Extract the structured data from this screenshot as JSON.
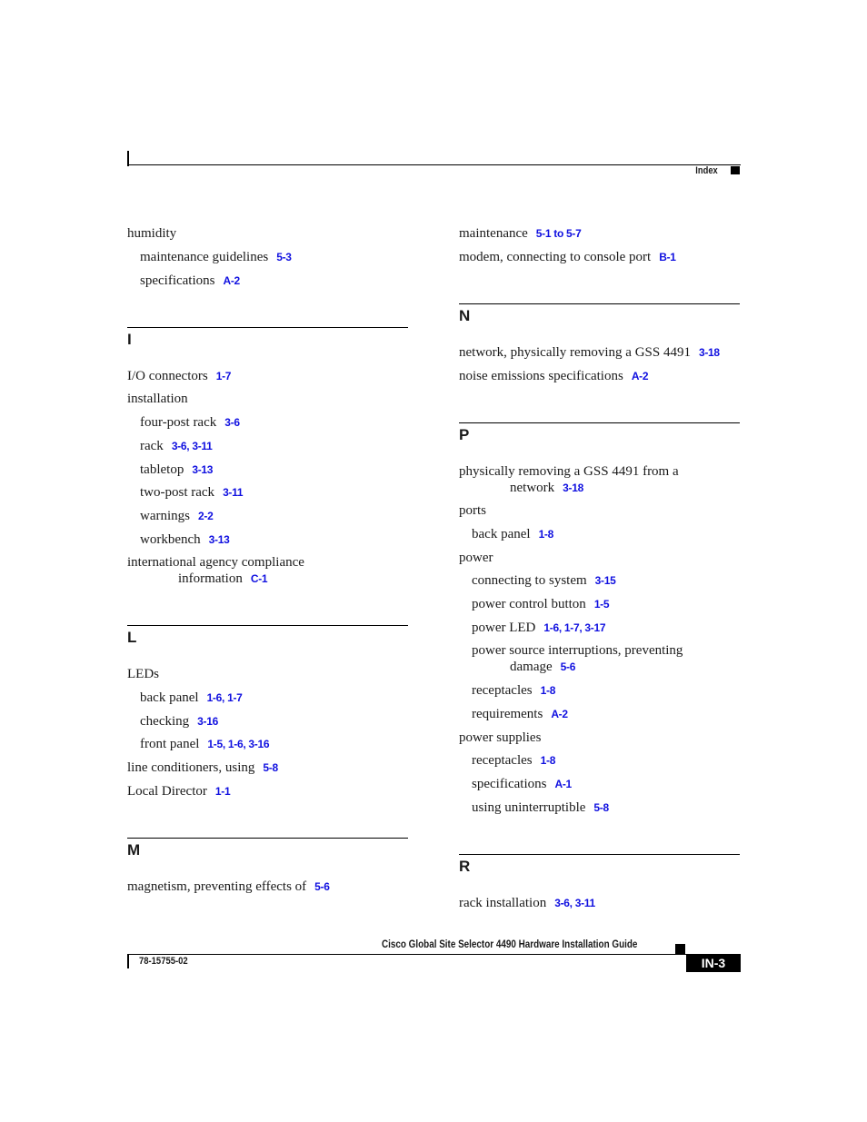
{
  "header": {
    "section_label": "Index"
  },
  "left_column": {
    "pre_entries": [
      {
        "term": "humidity",
        "refs": ""
      },
      {
        "term": "maintenance guidelines",
        "refs": "5-3"
      },
      {
        "term": "specifications",
        "refs": "A-2"
      }
    ],
    "sections": [
      {
        "letter": "I",
        "entries": [
          {
            "term": "I/O connectors",
            "refs": "1-7"
          },
          {
            "term": "installation",
            "refs": ""
          },
          {
            "term": "four-post rack",
            "refs": "3-6"
          },
          {
            "term": "rack",
            "refs": "3-6, 3-11"
          },
          {
            "term": "tabletop",
            "refs": "3-13"
          },
          {
            "term": "two-post rack",
            "refs": "3-11"
          },
          {
            "term": "warnings",
            "refs": "2-2"
          },
          {
            "term": "workbench",
            "refs": "3-13"
          },
          {
            "term": "international agency compliance",
            "cont": "information",
            "refs": "C-1"
          }
        ]
      },
      {
        "letter": "L",
        "entries": [
          {
            "term": "LEDs",
            "refs": ""
          },
          {
            "term": "back panel",
            "refs": "1-6, 1-7"
          },
          {
            "term": "checking",
            "refs": "3-16"
          },
          {
            "term": "front panel",
            "refs": "1-5, 1-6, 3-16"
          },
          {
            "term": "line conditioners, using",
            "refs": "5-8"
          },
          {
            "term": "Local Director",
            "refs": "1-1"
          }
        ]
      },
      {
        "letter": "M",
        "entries": [
          {
            "term": "magnetism, preventing effects of",
            "refs": "5-6"
          }
        ]
      }
    ]
  },
  "right_column": {
    "pre_entries": [
      {
        "term": "maintenance",
        "refs": "5-1 to 5-7"
      },
      {
        "term": "modem, connecting to console port",
        "refs": "B-1"
      }
    ],
    "sections": [
      {
        "letter": "N",
        "entries": [
          {
            "term": "network, physically removing a GSS 4491",
            "refs": "3-18"
          },
          {
            "term": "noise emissions specifications",
            "refs": "A-2"
          }
        ]
      },
      {
        "letter": "P",
        "entries": [
          {
            "term": "physically removing a GSS 4491 from a",
            "cont": "network",
            "refs": "3-18"
          },
          {
            "term": "ports",
            "refs": ""
          },
          {
            "term": "back panel",
            "refs": "1-8"
          },
          {
            "term": "power",
            "refs": ""
          },
          {
            "term": "connecting to system",
            "refs": "3-15"
          },
          {
            "term": "power control button",
            "refs": "1-5"
          },
          {
            "term": "power LED",
            "refs": "1-6, 1-7, 3-17"
          },
          {
            "term": "power source interruptions, preventing",
            "cont": "damage",
            "refs": "5-6"
          },
          {
            "term": "receptacles",
            "refs": "1-8"
          },
          {
            "term": "requirements",
            "refs": "A-2"
          },
          {
            "term": "power supplies",
            "refs": ""
          },
          {
            "term": "receptacles",
            "refs": "1-8"
          },
          {
            "term": "specifications",
            "refs": "A-1"
          },
          {
            "term": "using uninterruptible",
            "refs": "5-8"
          }
        ]
      },
      {
        "letter": "R",
        "entries": [
          {
            "term": "rack installation",
            "refs": "3-6, 3-11"
          }
        ]
      }
    ]
  },
  "footer": {
    "book_title": "Cisco Global Site Selector 4490 Hardware Installation Guide",
    "doc_number": "78-15755-02",
    "page_number": "IN-3"
  },
  "colors": {
    "link": "#1010e0",
    "text": "#1a1a1a"
  }
}
